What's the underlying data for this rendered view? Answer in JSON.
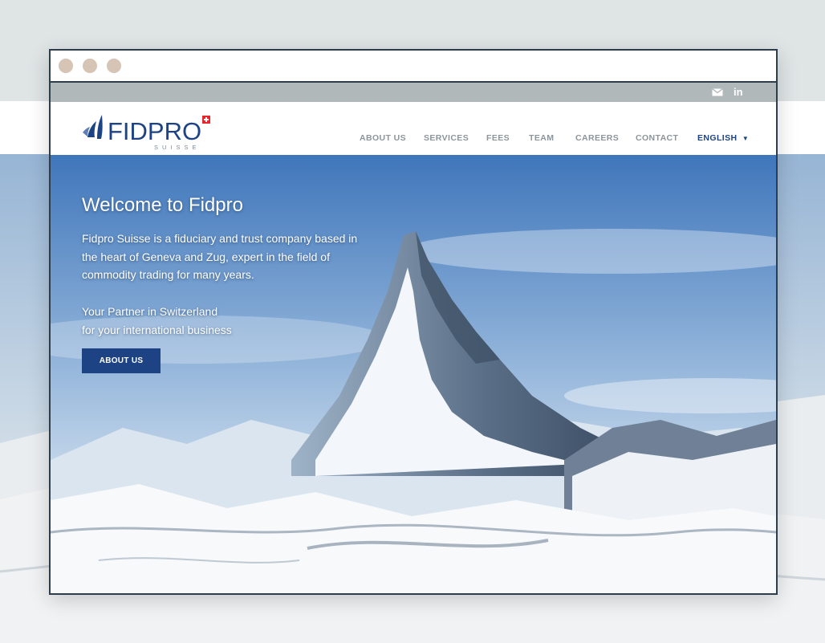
{
  "brand": {
    "name": "FIDPRO",
    "sub": "SUISSE",
    "blue": "#1d4385",
    "flag_red": "#e5262d"
  },
  "topbar": {
    "icons": [
      "email-icon",
      "linkedin-icon"
    ],
    "linkedin_text": "in"
  },
  "nav": {
    "items": [
      "ABOUT US",
      "SERVICES",
      "FEES",
      "TEAM",
      "CAREERS",
      "CONTACT"
    ],
    "language": "ENGLISH"
  },
  "hero": {
    "title": "Welcome to Fidpro",
    "lead": "Fidpro Suisse is a fiduciary and trust company based in the heart of Geneva and Zug, expert in the field of commodity trading for many years.",
    "tagline_1": "Your Partner in Switzerland",
    "tagline_2": "for your international business",
    "button": "ABOUT US"
  }
}
